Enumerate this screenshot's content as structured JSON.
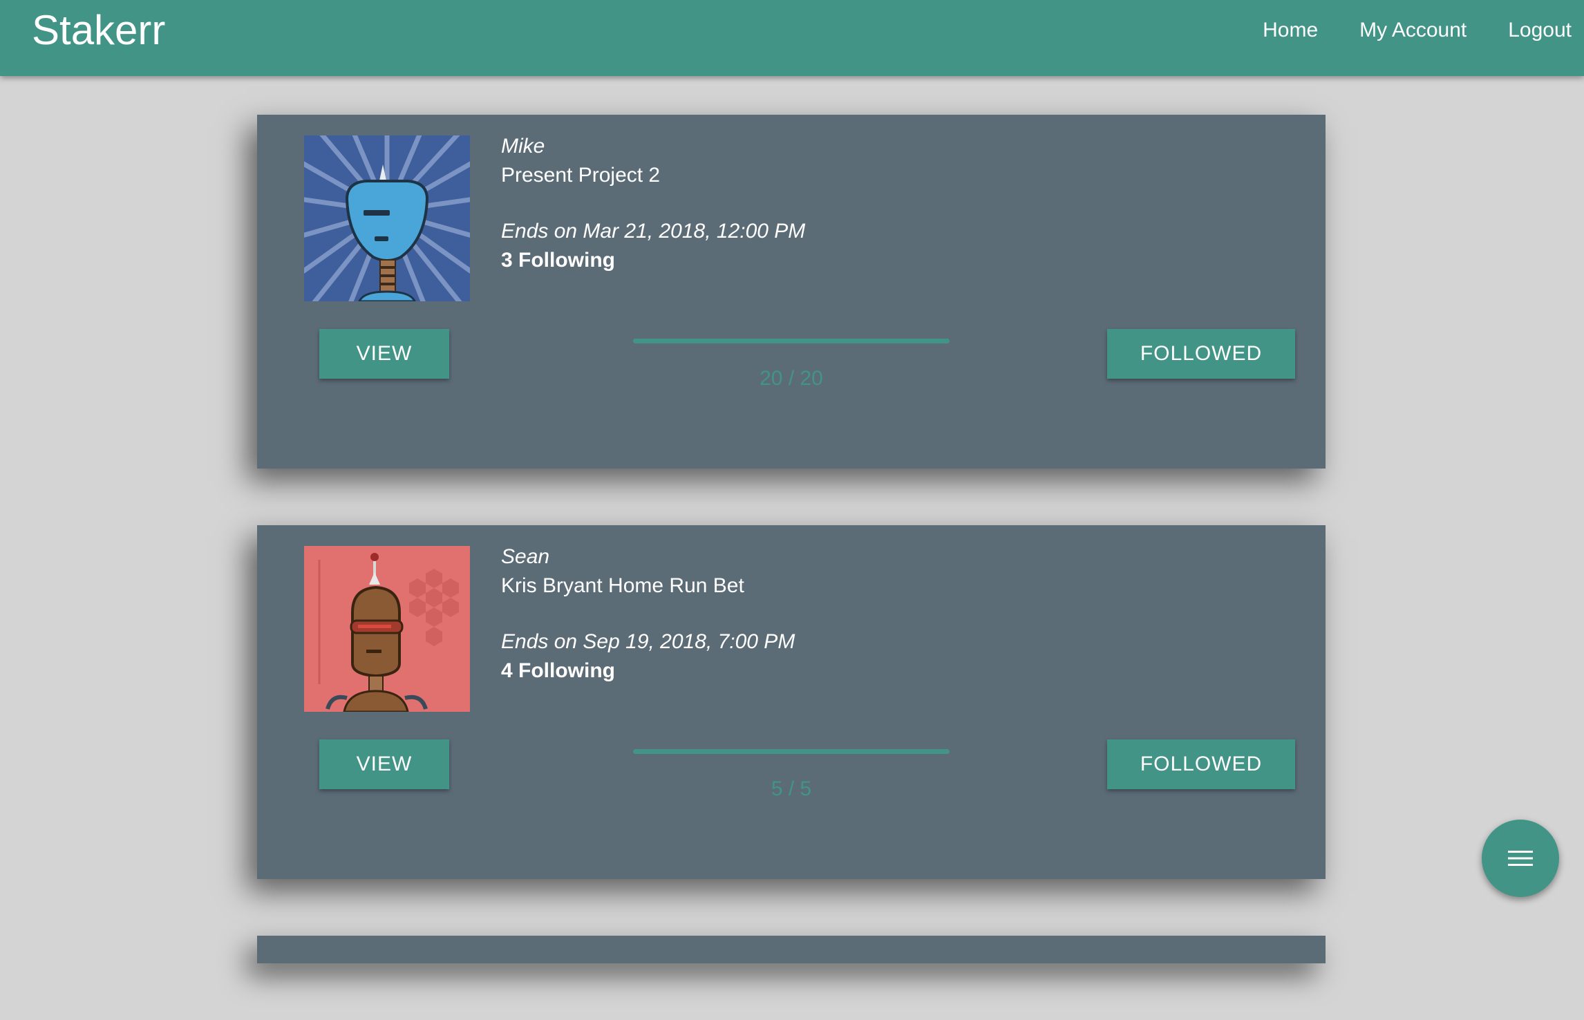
{
  "app": {
    "title": "Stakerr"
  },
  "nav": {
    "items": [
      {
        "label": "Home"
      },
      {
        "label": "My Account"
      },
      {
        "label": "Logout"
      }
    ]
  },
  "cards": [
    {
      "owner": "Mike",
      "project": "Present Project 2",
      "ends": "Ends on Mar 21, 2018, 12:00 PM",
      "following": "3 Following",
      "view_label": "VIEW",
      "follow_label": "FOLLOWED",
      "progress_text": "20 / 20",
      "progress_fraction": 1.0,
      "avatar_icon": "blue-robot-avatar-icon"
    },
    {
      "owner": "Sean",
      "project": "Kris Bryant Home Run Bet",
      "ends": "Ends on Sep 19, 2018, 7:00 PM",
      "following": "4 Following",
      "view_label": "VIEW",
      "follow_label": "FOLLOWED",
      "progress_text": "5 / 5",
      "progress_fraction": 1.0,
      "avatar_icon": "brown-robot-avatar-icon"
    }
  ],
  "fab": {
    "icon": "menu-icon"
  },
  "colors": {
    "primary": "#419486",
    "card": "#5c6c77",
    "background": "#d4d4d4"
  }
}
